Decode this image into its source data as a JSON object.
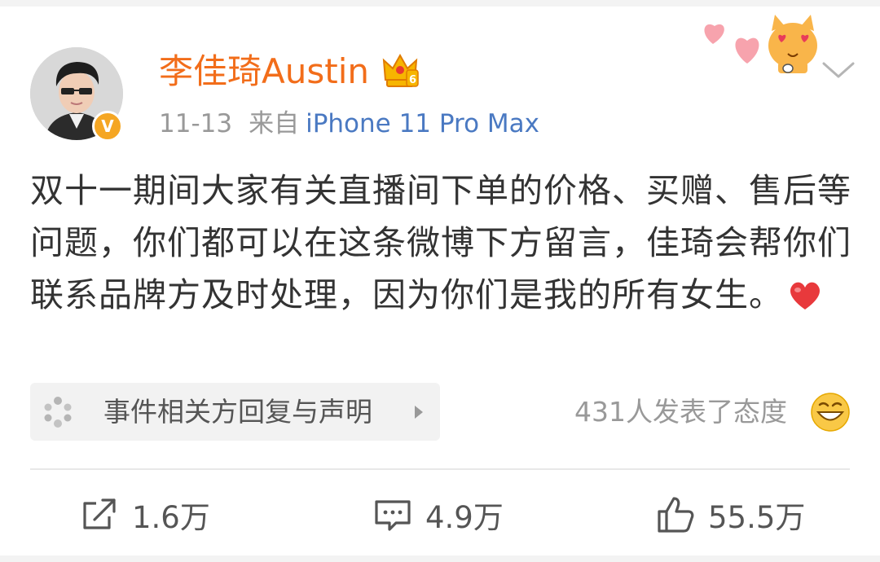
{
  "post": {
    "author": "李佳琦Austin",
    "time": "11-13",
    "source_prefix": "来自",
    "device": "iPhone 11 Pro Max",
    "content": "双十一期间大家有关直播间下单的价格、买赠、售后等问题，你们都可以在这条微博下方留言，佳琦会帮你们联系品牌方及时处理，因为你们是我的所有女生。"
  },
  "topic_card": {
    "label": "事件相关方回复与声明"
  },
  "attitude": {
    "text": "431人发表了态度"
  },
  "actions": {
    "repost": "1.6万",
    "comment": "4.9万",
    "like": "55.5万"
  },
  "colors": {
    "username": "#f26d1a",
    "device_link": "#4a79c2",
    "meta_gray": "#999999",
    "body_text": "#333333",
    "verified_badge": "#f5a623",
    "heart": "#e8393c"
  },
  "icons": {
    "verified": "verified-v-icon",
    "crown": "crown-membership-icon",
    "topic": "topic-spinner-icon",
    "heart": "red-heart-emoji",
    "laugh": "laughing-emoji",
    "repost": "repost-icon",
    "comment": "comment-icon",
    "like": "thumbs-up-icon",
    "more": "chevron-down-icon"
  }
}
